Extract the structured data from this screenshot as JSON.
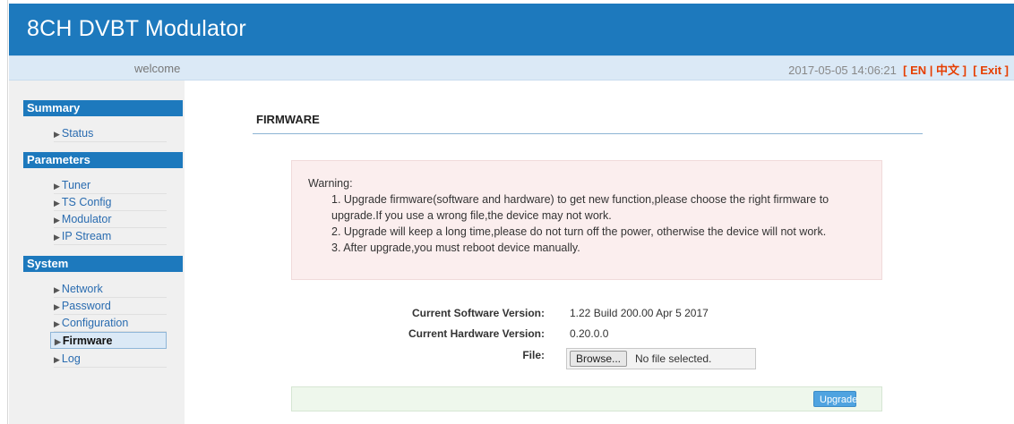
{
  "app": {
    "title": "8CH DVBT Modulator"
  },
  "topbar": {
    "welcome": "welcome",
    "datetime": "2017-05-05 14:06:21",
    "lang_en": "EN",
    "lang_sep": "|",
    "lang_zh": "中文",
    "exit": "Exit"
  },
  "sidebar": {
    "summary": {
      "heading": "Summary",
      "items": [
        {
          "label": "Status"
        }
      ]
    },
    "parameters": {
      "heading": "Parameters",
      "items": [
        {
          "label": "Tuner"
        },
        {
          "label": "TS Config"
        },
        {
          "label": "Modulator"
        },
        {
          "label": "IP Stream"
        }
      ]
    },
    "system": {
      "heading": "System",
      "items": [
        {
          "label": "Network"
        },
        {
          "label": "Password"
        },
        {
          "label": "Configuration"
        },
        {
          "label": "Firmware",
          "active": true
        },
        {
          "label": "Log"
        }
      ]
    }
  },
  "main": {
    "title": "FIRMWARE",
    "warning": {
      "heading": "Warning:",
      "lines": [
        "1. Upgrade firmware(software and hardware) to get new function,please choose the right firmware to",
        "upgrade.If you use a wrong file,the device may not work.",
        "2. Upgrade will keep a long time,please do not turn off the power, otherwise the device will not work.",
        "3. After upgrade,you must reboot device manually."
      ]
    },
    "software_label": "Current Software Version:",
    "software_value": "1.22 Build 200.00 Apr 5 2017",
    "hardware_label": "Current Hardware Version:",
    "hardware_value": "0.20.0.0",
    "file_label": "File:",
    "browse_label": "Browse...",
    "file_status": "No file selected.",
    "upgrade_label": "Upgrade"
  }
}
